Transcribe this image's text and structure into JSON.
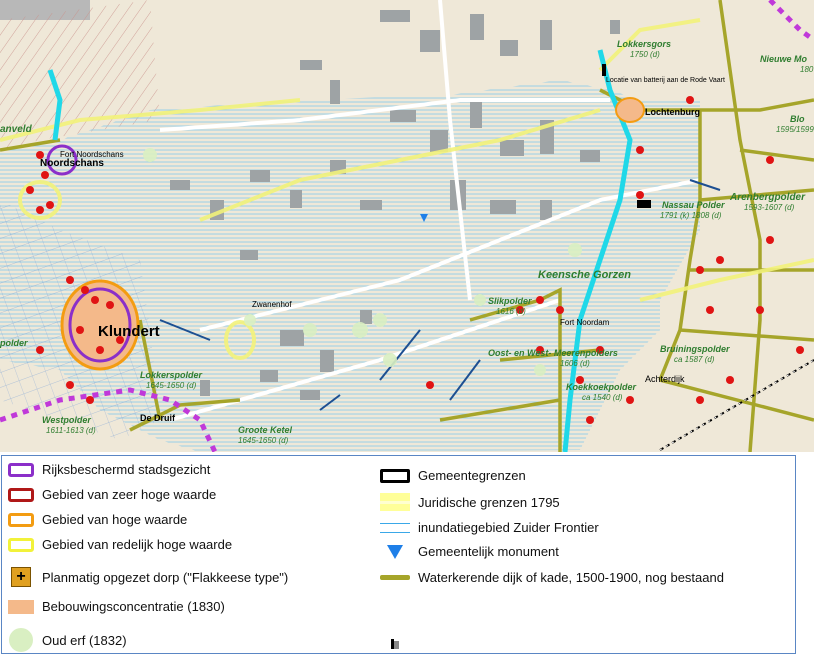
{
  "map": {
    "labels": {
      "klundert": "Klundert",
      "noordschans": "Noordschans",
      "fort_noordschans": "Fort Noordschans",
      "anveld": "anveld",
      "zwanenhof": "Zwanenhof",
      "de_druif": "De Druif",
      "lochtenburg": "Lochtenburg",
      "lokkersgors": "Lokkersgors",
      "lokkersgors_year": "1750 (d)",
      "battery": "Locatie van batterij aan de Rode Vaart",
      "nieuwe_mo": "Nieuwe Mo",
      "nieuwe_mo_year": "180",
      "blo": "Blo",
      "blo_year": "1595/1599",
      "arenbergpolder": "Arenbergpolder",
      "arenbergpolder_year": "1593-1607 (d)",
      "nassau_polder": "Nassau Polder",
      "nassau_polder_year": "1791 (k) 1808 (d)",
      "keensche_gorzen": "Keensche Gorzen",
      "slikpolder": "Slikpolder",
      "slikpolder_year": "1616 (d)",
      "fort_noordam": "Fort Noordam",
      "oost_west_meerenpolders": "Oost- en West- Meerenpolders",
      "oost_west_year": "1606 (d)",
      "koekkoekpolder": "Koekkoekpolder",
      "koekkoekpolder_year": "ca 1540 (d)",
      "achterdijk": "Achterdijk",
      "bruiningspolder": "Bruiningspolder",
      "bruiningspolder_year": "ca 1587 (d)",
      "lokkerspolder": "Lokkerspolder",
      "lokkerspolder_year": "1645-1650 (d)",
      "westpolder": "Westpolder",
      "westpolder_year": "1611-1613 (d)",
      "groote_ketel": "Groote Ketel",
      "groote_ketel_year": "1645-1650 (d)",
      "polder": "polder"
    }
  },
  "legend": {
    "items": [
      {
        "label": "Rijksbeschermd stadsgezicht",
        "color": "#8b2fc9"
      },
      {
        "label": "Gebied van zeer hoge waarde",
        "color": "#b01818"
      },
      {
        "label": "Gebied van hoge waarde",
        "color": "#f39c12"
      },
      {
        "label": "Gebied van redelijk hoge waarde",
        "color": "#f2f23a"
      },
      {
        "label": "Planmatig opgezet dorp (\"Flakkeese type\")",
        "color": "#e0a020"
      },
      {
        "label": "Bebouwingsconcentratie (1830)",
        "color": "#f4b98a"
      },
      {
        "label": "Oud erf (1832)",
        "color": "#d9efc2"
      },
      {
        "label": "Gemeentegrenzen",
        "color": "#000000"
      },
      {
        "label": "Juridische grenzen 1795",
        "color": "#ffff99"
      },
      {
        "label": "inundatiegebied Zuider Frontier",
        "color": "#3aa8e8"
      },
      {
        "label": "Gemeentelijk monument",
        "color": "#1e7fe8"
      },
      {
        "label": "Waterkerende dijk of kade, 1500-1900, nog bestaand",
        "color": "#a6a52a"
      }
    ]
  }
}
